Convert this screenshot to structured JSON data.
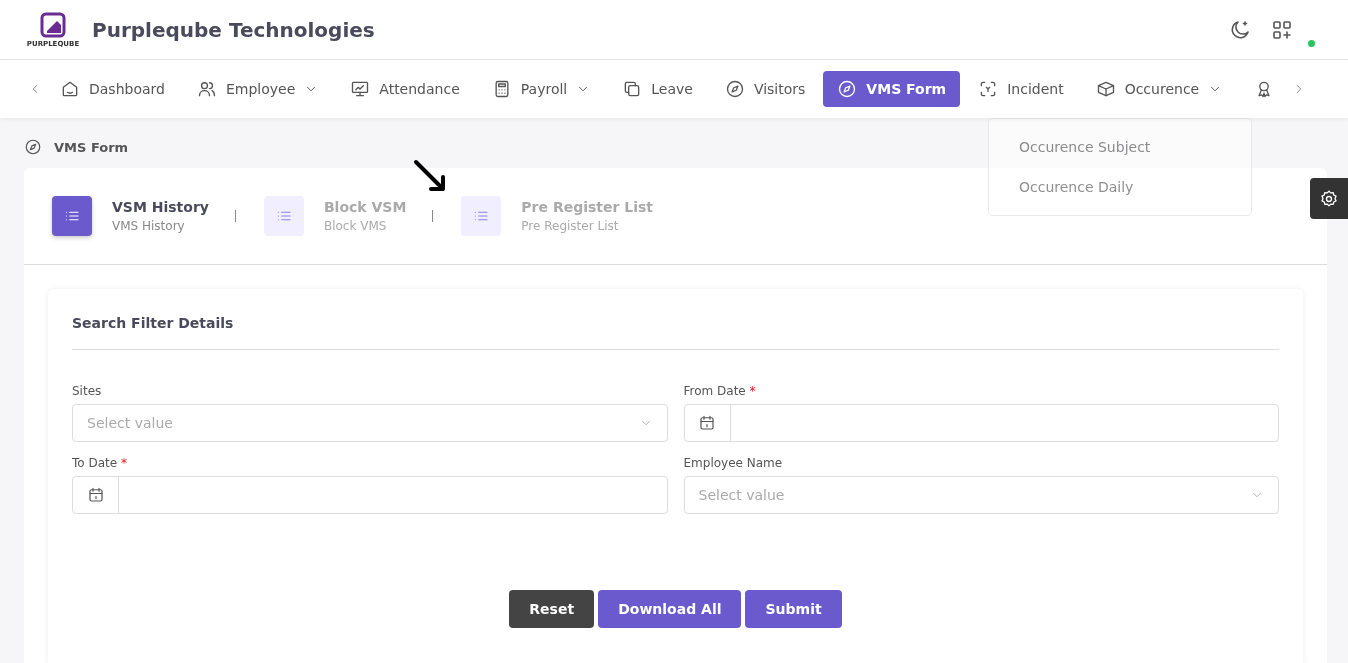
{
  "header": {
    "logo_text": "PURPLEQUBE",
    "company": "Purpleqube Technologies",
    "status_online": true
  },
  "nav": {
    "items": [
      {
        "label": "Dashboard",
        "dropdown": false,
        "selected": false
      },
      {
        "label": "Employee",
        "dropdown": true,
        "selected": false
      },
      {
        "label": "Attendance",
        "dropdown": false,
        "selected": false
      },
      {
        "label": "Payroll",
        "dropdown": true,
        "selected": false
      },
      {
        "label": "Leave",
        "dropdown": false,
        "selected": false
      },
      {
        "label": "Visitors",
        "dropdown": false,
        "selected": false
      },
      {
        "label": "VMS Form",
        "dropdown": false,
        "selected": true
      },
      {
        "label": "Incident",
        "dropdown": false,
        "selected": false
      },
      {
        "label": "Occurence",
        "dropdown": true,
        "selected": false
      }
    ],
    "submenu": [
      "Occurence Subject",
      "Occurence Daily"
    ]
  },
  "breadcrumb": "VMS Form",
  "steps": [
    {
      "title": "VSM History",
      "subtitle": "VMS History",
      "selected": true
    },
    {
      "title": "Block VSM",
      "subtitle": "Block VMS",
      "selected": false
    },
    {
      "title": "Pre Register List",
      "subtitle": "Pre Register List",
      "selected": false
    }
  ],
  "filter": {
    "title": "Search Filter Details",
    "fields": [
      {
        "kind": "select",
        "label": "Sites",
        "required": false,
        "placeholder": "Select value"
      },
      {
        "kind": "date",
        "label": "From Date",
        "required": true
      },
      {
        "kind": "date",
        "label": "To Date",
        "required": true
      },
      {
        "kind": "select",
        "label": "Employee Name",
        "required": false,
        "placeholder": "Select value"
      }
    ],
    "required_mark": "*",
    "buttons": [
      {
        "label": "Reset",
        "kind": "dark"
      },
      {
        "label": "Download All",
        "kind": "primary"
      },
      {
        "label": "Submit",
        "kind": "primary"
      }
    ]
  }
}
